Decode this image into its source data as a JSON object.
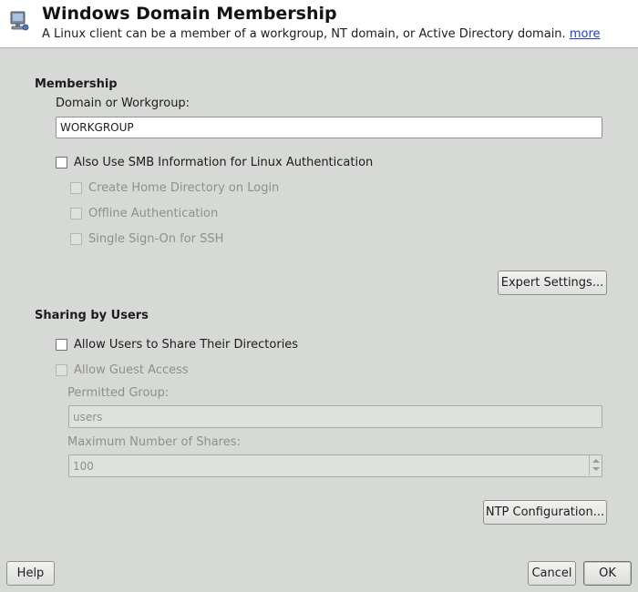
{
  "header": {
    "title": "Windows Domain Membership",
    "subtitle": "A Linux client can be a member of a workgroup, NT domain, or Active Directory domain.",
    "more_link": "more",
    "icon": "network-computer-icon"
  },
  "membership": {
    "section_title": "Membership",
    "domain_label": "Domain or Workgroup:",
    "domain_value": "WORKGROUP",
    "use_smb_label": "Also Use SMB Information for Linux Authentication",
    "create_home_label": "Create Home Directory on Login",
    "offline_auth_label": "Offline Authentication",
    "sso_label": "Single Sign-On for SSH",
    "expert_button": "Expert Settings..."
  },
  "sharing": {
    "section_title": "Sharing by Users",
    "allow_share_label": "Allow Users to Share Their Directories",
    "guest_access_label": "Allow Guest Access",
    "permitted_group_label": "Permitted Group:",
    "permitted_group_value": "users",
    "max_shares_label": "Maximum Number of Shares:",
    "max_shares_value": "100",
    "ntp_button": "NTP Configuration..."
  },
  "footer": {
    "help_button": "Help",
    "cancel_button": "Cancel",
    "ok_button": "OK"
  }
}
